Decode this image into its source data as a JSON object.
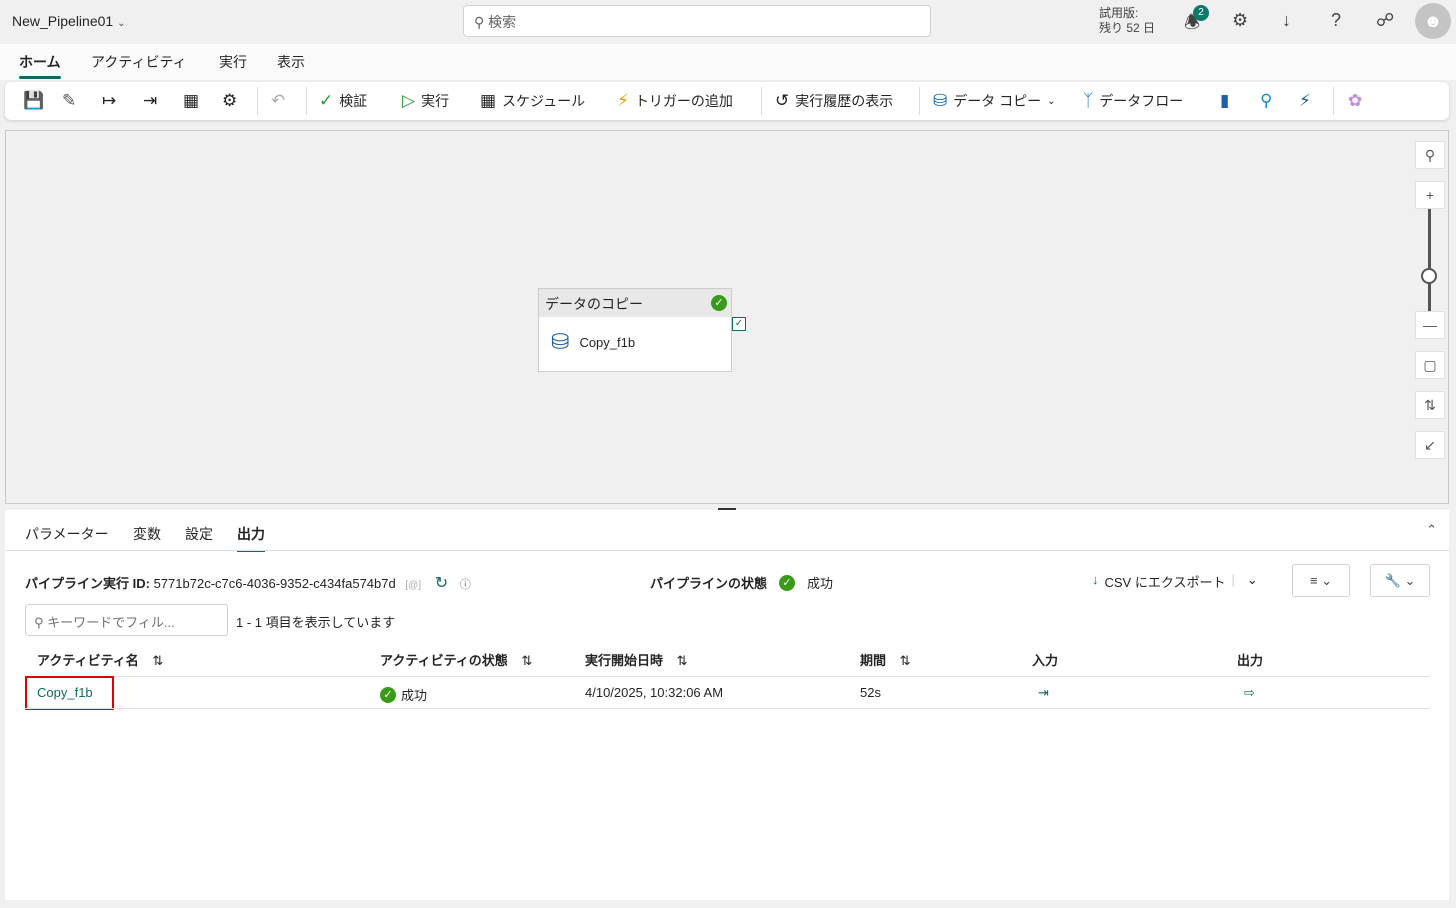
{
  "header": {
    "title": "New_Pipeline01",
    "search_placeholder": "検索",
    "trial_line1": "試用版:",
    "trial_line2": "残り 52 日",
    "notification_count": "2"
  },
  "ribbon_tabs": [
    "ホーム",
    "アクティビティ",
    "実行",
    "表示"
  ],
  "toolbar": {
    "validate": "検証",
    "run": "実行",
    "schedule": "スケジュール",
    "add_trigger": "トリガーの追加",
    "view_history": "実行履歴の表示",
    "copy_data": "データ コピー",
    "dataflow": "データフロー"
  },
  "canvas": {
    "node_title": "データのコピー",
    "node_activity": "Copy_f1b"
  },
  "panel": {
    "tabs": [
      "パラメーター",
      "変数",
      "設定",
      "出力"
    ],
    "run_id_label": "パイプライン実行 ID:",
    "run_id": "5771b72c-c7c6-4036-9352-c434fa574b7d",
    "status_label": "パイプラインの状態",
    "status": "成功",
    "export_csv": "CSV にエクスポート",
    "filter_placeholder": "キーワードでフィル...",
    "count_text": "1 - 1 項目を表示しています",
    "columns": [
      "アクティビティ名",
      "アクティビティの状態",
      "実行開始日時",
      "期間",
      "入力",
      "出力"
    ],
    "rows": [
      {
        "name": "Copy_f1b",
        "status": "成功",
        "start": "4/10/2025, 10:32:06 AM",
        "duration": "52s"
      }
    ]
  },
  "colors": {
    "accent": "#0e6b5e",
    "success": "#3a9a1a",
    "highlight": "#e00000"
  }
}
